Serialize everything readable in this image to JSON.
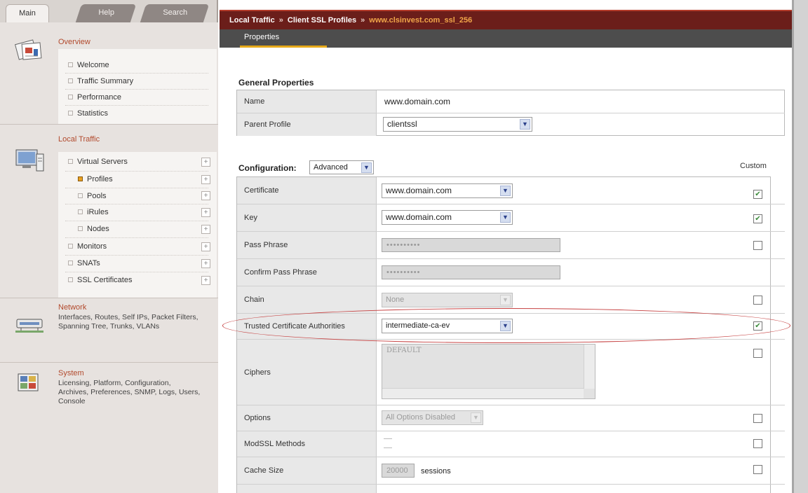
{
  "nav": {
    "tabs": [
      "Main",
      "Help",
      "Search"
    ],
    "overview": {
      "title": "Overview",
      "items": [
        "Welcome",
        "Traffic Summary",
        "Performance",
        "Statistics"
      ]
    },
    "local_traffic": {
      "title": "Local Traffic",
      "items": [
        "Virtual Servers",
        "Profiles",
        "Pools",
        "iRules",
        "Nodes",
        "Monitors",
        "SNATs",
        "SSL Certificates"
      ],
      "selected": "Profiles"
    },
    "network": {
      "title": "Network",
      "desc": "Interfaces, Routes, Self IPs, Packet Filters, Spanning Tree, Trunks, VLANs"
    },
    "system": {
      "title": "System",
      "desc": "Licensing, Platform, Configuration, Archives, Preferences, SNMP, Logs, Users, Console"
    }
  },
  "breadcrumb": {
    "parts": [
      "Local Traffic",
      "Client SSL Profiles",
      "www.clsinvest.com_ssl_256"
    ],
    "separator": "»"
  },
  "tabs": {
    "active": "Properties"
  },
  "general": {
    "heading": "General Properties",
    "name_label": "Name",
    "name_value": "www.domain.com",
    "parent_label": "Parent Profile",
    "parent_value": "clientssl"
  },
  "config": {
    "heading": "Configuration:",
    "mode_value": "Advanced",
    "custom_header": "Custom",
    "certificate_label": "Certificate",
    "certificate_value": "www.domain.com",
    "key_label": "Key",
    "key_value": "www.domain.com",
    "passphrase_label": "Pass Phrase",
    "passphrase_value": "••••••••••",
    "confirm_label": "Confirm Pass Phrase",
    "confirm_value": "••••••••••",
    "chain_label": "Chain",
    "chain_value": "None",
    "trusted_label": "Trusted Certificate Authorities",
    "trusted_value": "intermediate-ca-ev",
    "ciphers_label": "Ciphers",
    "ciphers_value": "DEFAULT",
    "options_label": "Options",
    "options_value": "All Options Disabled",
    "modssl_label": "ModSSL Methods",
    "cache_label": "Cache Size",
    "cache_value": "20000",
    "cache_unit": "sessions"
  },
  "custom_checks": {
    "certificate": true,
    "key": true,
    "passphrase": false,
    "chain": false,
    "trusted": true,
    "ciphers": false,
    "options": false,
    "modssl": false,
    "cache": false
  },
  "colors": {
    "breadcrumb_bg": "#6b1e1a",
    "breadcrumb_current": "#f0a64a",
    "highlight_ellipse": "#c64242",
    "nav_section_title": "#b24a2d"
  }
}
